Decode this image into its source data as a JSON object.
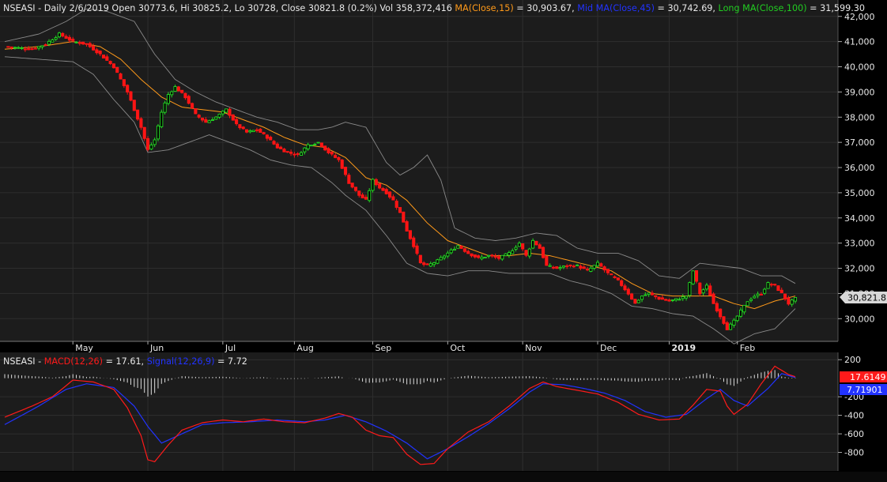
{
  "colors": {
    "background": "#000000",
    "panel": "#1c1c1c",
    "grid": "#2e2e2e",
    "axis_text": "#e8e8e8",
    "up": "#22dd22",
    "down": "#ff1515",
    "ma15": "#ff9a1a",
    "band": "#8a8a8a",
    "macd": "#ff1a1a",
    "signal": "#2233ff",
    "hist": "#dcdcdc"
  },
  "price_header": {
    "symbol_info": "NSEASI - Daily 2/6/2019 Open 30773.6, Hi 30825.2, Lo 30728, Close 30821.8 (0.2%) Vol 358,372,416",
    "ma15_label": "MA(Close,15)",
    "ma15_value": " = 30,903.67,",
    "mid_label": "Mid MA(Close,45)",
    "mid_value": " = 30,742.69,",
    "long_label": "Long MA(Close,100)",
    "long_value": " = 31,599.30"
  },
  "macd_header": {
    "symbol": "NSEASI - ",
    "macd_label": "MACD(12,26)",
    "macd_value": " = 17.61, ",
    "signal_label": "Signal(12,26,9)",
    "signal_value": " = 7.72"
  },
  "last_price_tag": "30,821.8",
  "macd_tag": "17.6149",
  "signal_tag": "7.71901",
  "chart_data": [
    {
      "type": "candlestick",
      "x_ticks": [
        {
          "label": "May",
          "date": "2018-05"
        },
        {
          "label": "Jun",
          "date": "2018-06"
        },
        {
          "label": "Jul",
          "date": "2018-07"
        },
        {
          "label": "Aug",
          "date": "2018-08"
        },
        {
          "label": "Sep",
          "date": "2018-09"
        },
        {
          "label": "Oct",
          "date": "2018-10"
        },
        {
          "label": "Nov",
          "date": "2018-11"
        },
        {
          "label": "Dec",
          "date": "2018-12"
        },
        {
          "label": "2019",
          "date": "2019-01"
        },
        {
          "label": "Feb",
          "date": "2019-02"
        }
      ],
      "y_ticks": [
        "30,000",
        "31,000",
        "32,000",
        "33,000",
        "34,000",
        "35,000",
        "36,000",
        "37,000",
        "38,000",
        "39,000",
        "40,000",
        "41,000",
        "42,000"
      ],
      "y_tick_values": [
        30000,
        31000,
        32000,
        33000,
        34000,
        35000,
        36000,
        37000,
        38000,
        39000,
        40000,
        41000,
        42000
      ],
      "ylim": [
        29100,
        42400
      ],
      "close_anchors": [
        [
          0,
          40800
        ],
        [
          8,
          40700
        ],
        [
          12,
          40900
        ],
        [
          16,
          41300
        ],
        [
          20,
          41000
        ],
        [
          24,
          40900
        ],
        [
          28,
          40500
        ],
        [
          32,
          40000
        ],
        [
          36,
          39000
        ],
        [
          40,
          37600
        ],
        [
          42,
          36700
        ],
        [
          44,
          37100
        ],
        [
          46,
          38200
        ],
        [
          48,
          38900
        ],
        [
          50,
          39200
        ],
        [
          53,
          38800
        ],
        [
          56,
          38100
        ],
        [
          59,
          37800
        ],
        [
          62,
          38000
        ],
        [
          65,
          38300
        ],
        [
          68,
          37700
        ],
        [
          71,
          37400
        ],
        [
          74,
          37500
        ],
        [
          77,
          37200
        ],
        [
          80,
          36800
        ],
        [
          83,
          36600
        ],
        [
          86,
          36500
        ],
        [
          89,
          36900
        ],
        [
          92,
          37000
        ],
        [
          95,
          36600
        ],
        [
          98,
          36300
        ],
        [
          101,
          35400
        ],
        [
          104,
          34900
        ],
        [
          106,
          34700
        ],
        [
          108,
          35500
        ],
        [
          110,
          35200
        ],
        [
          112,
          35000
        ],
        [
          114,
          34700
        ],
        [
          116,
          34200
        ],
        [
          118,
          33500
        ],
        [
          120,
          32900
        ],
        [
          122,
          32200
        ],
        [
          124,
          32100
        ],
        [
          127,
          32300
        ],
        [
          130,
          32600
        ],
        [
          133,
          32900
        ],
        [
          136,
          32600
        ],
        [
          139,
          32400
        ],
        [
          142,
          32500
        ],
        [
          145,
          32400
        ],
        [
          148,
          32600
        ],
        [
          151,
          33000
        ],
        [
          153,
          32500
        ],
        [
          155,
          33100
        ],
        [
          157,
          32800
        ],
        [
          159,
          32100
        ],
        [
          162,
          32000
        ],
        [
          165,
          32100
        ],
        [
          168,
          32100
        ],
        [
          171,
          31900
        ],
        [
          174,
          32200
        ],
        [
          177,
          31800
        ],
        [
          180,
          31500
        ],
        [
          183,
          31000
        ],
        [
          185,
          30600
        ],
        [
          187,
          30900
        ],
        [
          189,
          31000
        ],
        [
          192,
          30800
        ],
        [
          195,
          30700
        ],
        [
          198,
          30800
        ],
        [
          200,
          30900
        ],
        [
          202,
          31900
        ],
        [
          204,
          31000
        ],
        [
          206,
          31300
        ],
        [
          208,
          30600
        ],
        [
          210,
          30100
        ],
        [
          212,
          29600
        ],
        [
          214,
          29900
        ],
        [
          216,
          30300
        ],
        [
          218,
          30700
        ],
        [
          220,
          30900
        ],
        [
          222,
          31000
        ],
        [
          224,
          31400
        ],
        [
          226,
          31300
        ],
        [
          228,
          31000
        ],
        [
          230,
          30600
        ],
        [
          232,
          30800
        ]
      ],
      "ma15_anchors": [
        [
          0,
          40700
        ],
        [
          10,
          40800
        ],
        [
          20,
          41000
        ],
        [
          28,
          40800
        ],
        [
          34,
          40300
        ],
        [
          40,
          39500
        ],
        [
          46,
          38800
        ],
        [
          52,
          38400
        ],
        [
          58,
          38300
        ],
        [
          64,
          38200
        ],
        [
          70,
          37900
        ],
        [
          76,
          37600
        ],
        [
          82,
          37200
        ],
        [
          88,
          36900
        ],
        [
          94,
          36800
        ],
        [
          100,
          36400
        ],
        [
          106,
          35600
        ],
        [
          112,
          35300
        ],
        [
          118,
          34700
        ],
        [
          124,
          33800
        ],
        [
          130,
          33100
        ],
        [
          136,
          32800
        ],
        [
          142,
          32500
        ],
        [
          148,
          32500
        ],
        [
          154,
          32600
        ],
        [
          160,
          32500
        ],
        [
          166,
          32300
        ],
        [
          172,
          32100
        ],
        [
          178,
          31900
        ],
        [
          184,
          31400
        ],
        [
          190,
          31000
        ],
        [
          196,
          30900
        ],
        [
          202,
          30900
        ],
        [
          208,
          30900
        ],
        [
          214,
          30600
        ],
        [
          220,
          30400
        ],
        [
          226,
          30700
        ],
        [
          232,
          30900
        ]
      ],
      "band_upper_anchors": [
        [
          0,
          41000
        ],
        [
          10,
          41300
        ],
        [
          18,
          41800
        ],
        [
          24,
          42300
        ],
        [
          30,
          42200
        ],
        [
          38,
          41800
        ],
        [
          44,
          40500
        ],
        [
          50,
          39500
        ],
        [
          56,
          39000
        ],
        [
          62,
          38600
        ],
        [
          68,
          38300
        ],
        [
          74,
          38000
        ],
        [
          80,
          37800
        ],
        [
          86,
          37500
        ],
        [
          92,
          37500
        ],
        [
          96,
          37600
        ],
        [
          100,
          37800
        ],
        [
          106,
          37600
        ],
        [
          112,
          36200
        ],
        [
          116,
          35700
        ],
        [
          120,
          36000
        ],
        [
          124,
          36500
        ],
        [
          128,
          35500
        ],
        [
          132,
          33600
        ],
        [
          138,
          33200
        ],
        [
          144,
          33100
        ],
        [
          150,
          33200
        ],
        [
          156,
          33400
        ],
        [
          162,
          33300
        ],
        [
          168,
          32800
        ],
        [
          174,
          32600
        ],
        [
          180,
          32600
        ],
        [
          186,
          32300
        ],
        [
          192,
          31700
        ],
        [
          198,
          31600
        ],
        [
          204,
          32200
        ],
        [
          210,
          32100
        ],
        [
          216,
          32000
        ],
        [
          222,
          31700
        ],
        [
          228,
          31700
        ],
        [
          232,
          31400
        ]
      ],
      "band_lower_anchors": [
        [
          0,
          40400
        ],
        [
          10,
          40300
        ],
        [
          20,
          40200
        ],
        [
          26,
          39700
        ],
        [
          32,
          38700
        ],
        [
          38,
          37800
        ],
        [
          42,
          36600
        ],
        [
          48,
          36700
        ],
        [
          54,
          37000
        ],
        [
          60,
          37300
        ],
        [
          66,
          37000
        ],
        [
          72,
          36700
        ],
        [
          78,
          36300
        ],
        [
          84,
          36100
        ],
        [
          90,
          36000
        ],
        [
          96,
          35400
        ],
        [
          100,
          34900
        ],
        [
          106,
          34300
        ],
        [
          112,
          33300
        ],
        [
          118,
          32200
        ],
        [
          124,
          31800
        ],
        [
          130,
          31700
        ],
        [
          136,
          31900
        ],
        [
          142,
          31900
        ],
        [
          148,
          31800
        ],
        [
          154,
          31800
        ],
        [
          160,
          31800
        ],
        [
          166,
          31500
        ],
        [
          172,
          31300
        ],
        [
          178,
          31000
        ],
        [
          184,
          30500
        ],
        [
          190,
          30400
        ],
        [
          196,
          30200
        ],
        [
          202,
          30100
        ],
        [
          208,
          29600
        ],
        [
          214,
          29000
        ],
        [
          220,
          29400
        ],
        [
          226,
          29600
        ],
        [
          232,
          30400
        ]
      ]
    },
    {
      "type": "line",
      "y_ticks": [
        "200",
        "-200",
        "-400",
        "-600",
        "-800"
      ],
      "y_tick_values": [
        200,
        -200,
        -400,
        -600,
        -800
      ],
      "ylim": [
        -1000,
        270
      ],
      "series": [
        {
          "name": "MACD(12,26)",
          "anchors": [
            [
              0,
              -420
            ],
            [
              8,
              -300
            ],
            [
              14,
              -200
            ],
            [
              20,
              -20
            ],
            [
              26,
              -40
            ],
            [
              32,
              -120
            ],
            [
              36,
              -320
            ],
            [
              40,
              -620
            ],
            [
              42,
              -880
            ],
            [
              44,
              -900
            ],
            [
              48,
              -720
            ],
            [
              52,
              -560
            ],
            [
              58,
              -480
            ],
            [
              64,
              -450
            ],
            [
              70,
              -470
            ],
            [
              76,
              -440
            ],
            [
              82,
              -470
            ],
            [
              88,
              -480
            ],
            [
              94,
              -430
            ],
            [
              98,
              -380
            ],
            [
              102,
              -420
            ],
            [
              106,
              -560
            ],
            [
              110,
              -620
            ],
            [
              114,
              -640
            ],
            [
              118,
              -820
            ],
            [
              122,
              -930
            ],
            [
              126,
              -920
            ],
            [
              130,
              -760
            ],
            [
              136,
              -580
            ],
            [
              142,
              -470
            ],
            [
              148,
              -300
            ],
            [
              154,
              -110
            ],
            [
              158,
              -40
            ],
            [
              162,
              -90
            ],
            [
              168,
              -130
            ],
            [
              174,
              -170
            ],
            [
              180,
              -260
            ],
            [
              186,
              -390
            ],
            [
              192,
              -450
            ],
            [
              198,
              -440
            ],
            [
              202,
              -290
            ],
            [
              206,
              -120
            ],
            [
              210,
              -140
            ],
            [
              212,
              -300
            ],
            [
              214,
              -390
            ],
            [
              218,
              -280
            ],
            [
              222,
              -60
            ],
            [
              226,
              130
            ],
            [
              230,
              40
            ],
            [
              232,
              17
            ]
          ]
        },
        {
          "name": "Signal(12,26,9)",
          "anchors": [
            [
              0,
              -500
            ],
            [
              10,
              -300
            ],
            [
              18,
              -120
            ],
            [
              24,
              -60
            ],
            [
              32,
              -100
            ],
            [
              38,
              -300
            ],
            [
              42,
              -520
            ],
            [
              46,
              -700
            ],
            [
              52,
              -600
            ],
            [
              58,
              -500
            ],
            [
              64,
              -480
            ],
            [
              72,
              -470
            ],
            [
              80,
              -450
            ],
            [
              88,
              -470
            ],
            [
              94,
              -450
            ],
            [
              100,
              -400
            ],
            [
              106,
              -470
            ],
            [
              112,
              -570
            ],
            [
              118,
              -700
            ],
            [
              124,
              -870
            ],
            [
              130,
              -760
            ],
            [
              136,
              -630
            ],
            [
              142,
              -490
            ],
            [
              148,
              -330
            ],
            [
              154,
              -150
            ],
            [
              158,
              -60
            ],
            [
              164,
              -70
            ],
            [
              170,
              -110
            ],
            [
              176,
              -160
            ],
            [
              182,
              -240
            ],
            [
              188,
              -360
            ],
            [
              194,
              -420
            ],
            [
              200,
              -390
            ],
            [
              206,
              -220
            ],
            [
              210,
              -120
            ],
            [
              214,
              -240
            ],
            [
              218,
              -300
            ],
            [
              224,
              -110
            ],
            [
              228,
              50
            ],
            [
              232,
              8
            ]
          ]
        }
      ]
    }
  ]
}
